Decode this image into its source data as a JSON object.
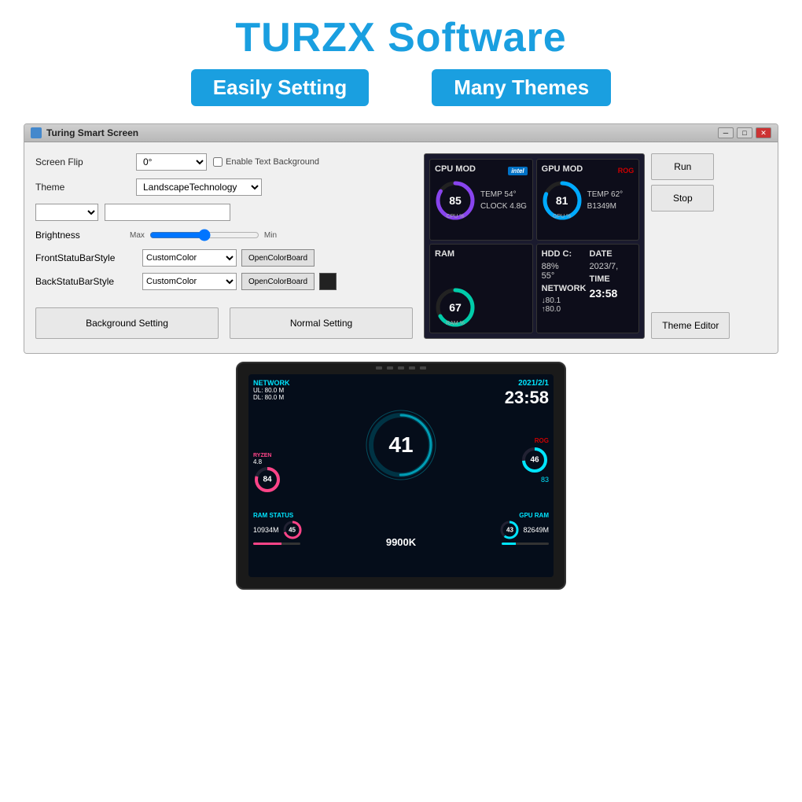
{
  "header": {
    "title": "TURZX Software",
    "badge1": "Easily Setting",
    "badge2": "Many Themes"
  },
  "window": {
    "title": "Turing Smart Screen",
    "screenFlip": {
      "label": "Screen Flip",
      "value": "0°",
      "enableTextBg": "Enable Text Background"
    },
    "theme": {
      "label": "Theme",
      "value": "LandscapeTechnology"
    },
    "brightness": {
      "label": "Brightness",
      "maxLabel": "Max",
      "minLabel": "Min"
    },
    "frontStatuBar": {
      "label": "FrontStatuBarStyle",
      "value": "CustomColor",
      "btnLabel": "OpenColorBoard"
    },
    "backStatuBar": {
      "label": "BackStatuBarStyle",
      "value": "CustomColor",
      "btnLabel": "OpenColorBoard"
    },
    "buttons": {
      "backgroundSetting": "Background Setting",
      "normalSetting": "Normal Setting",
      "run": "Run",
      "stop": "Stop",
      "themeEditor": "Theme Editor"
    }
  },
  "monitor": {
    "cpu": {
      "title": "CPU MOD",
      "logo": "intel",
      "value": "85",
      "sub": "CPU %",
      "temp": "TEMP  54°",
      "clock": "CLOCK 4.8G"
    },
    "gpu": {
      "title": "GPU MOD",
      "logo": "ROG",
      "value": "81",
      "sub": "GPU %",
      "temp": "TEMP  62°",
      "clock": "B1349M"
    },
    "ram": {
      "title": "RAM",
      "value": "67",
      "sub": "RAM %"
    },
    "hdd": {
      "title": "HDD C:",
      "percent": "88%",
      "temp": "55°"
    },
    "network": {
      "label": "NETWORK",
      "down": "↓80.1",
      "up": "↑80.0"
    },
    "date": {
      "label": "DATE",
      "value": "2023/7,"
    },
    "time": {
      "label": "TIME",
      "value": "23:58"
    }
  },
  "device": {
    "network": {
      "label": "NETWORK",
      "ul": "UL:  80.0 M",
      "dl": "DL:  80.0 M"
    },
    "date": "2021/2/1",
    "time": "23:58",
    "cpu": {
      "brand": "RYZEN",
      "clock": "4.8",
      "value": "84",
      "center": "41"
    },
    "gpu": {
      "value": "46",
      "sub": "83"
    },
    "ram": {
      "label": "RAM STATUS",
      "total": "10934M",
      "value": "45"
    },
    "cpu2": {
      "label": "9900K"
    },
    "temp": "43",
    "gpuram": {
      "label": "GPU RAM",
      "value": "82649M"
    }
  }
}
